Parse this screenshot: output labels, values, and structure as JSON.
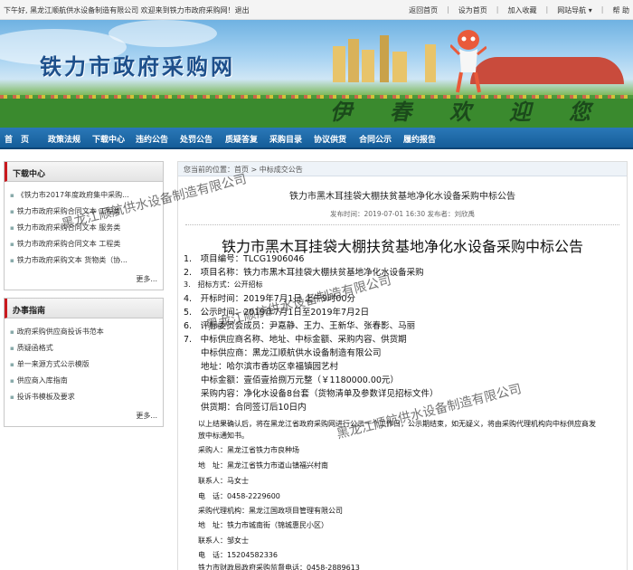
{
  "topbar": {
    "greeting": "下午好, 黑龙江顺航供水设备制造有限公司 欢迎来到铁力市政府采购网！退出",
    "links": [
      "返回首页",
      "设为首页",
      "加入收藏",
      "网站导航 ▾",
      "帮 助"
    ]
  },
  "banner": {
    "site_title": "铁力市政府采购网",
    "welcome": "伊春欢迎您"
  },
  "nav": {
    "items": [
      "首　页",
      "政策法规",
      "下载中心",
      "违约公告",
      "处罚公告",
      "质疑答复",
      "采购目录",
      "协议供货",
      "合同公示",
      "履约报告"
    ]
  },
  "sidebar": {
    "download": {
      "title": "下载中心",
      "items": [
        "《铁力市2017年度政府集中采购...",
        "铁力市政府采购合同文本 工程类",
        "铁力市政府采购合同文本 服务类",
        "铁力市政府采购合同文本 工程类",
        "铁力市政府采购文本 货物类（协..."
      ],
      "more": "更多..."
    },
    "guide": {
      "title": "办事指南",
      "items": [
        "政府采购供应商投诉书范本",
        "质疑函格式",
        "单一来源方式公示模版",
        "供应商入库指南",
        "投诉书模板及要求"
      ],
      "more": "更多..."
    }
  },
  "main": {
    "breadcrumb": "您当前的位置：首页 > 中标成交公告",
    "article_title": "铁力市黑木耳挂袋大棚扶贫基地净化水设备采购中标公告",
    "meta": "发布时间：2019-07-01 16:30  发布者：刘欣禹",
    "body_title": "铁力市黑木耳挂袋大棚扶贫基地净化水设备采购中标公告",
    "lines": [
      "1.　项目编号：TLCG1906046",
      "2.　项目名称：铁力市黑木耳挂袋大棚扶贫基地净化水设备采购",
      "3.　招标方式：公开招标",
      "4.　开标时间：2019年7月1日 上午9时00分",
      "5.　公示时间：2019年7月1日至2019年7月2日",
      "6.　评标委员会成员：尹嘉静、王力、王新华、张春影、马丽",
      "7.　中标供应商名称、地址、中标金额、采购内容、供货期",
      "　　中标供应商：黑龙江顺航供水设备制造有限公司",
      "　　地址：哈尔滨市香坊区幸福镇园艺村",
      "　　中标金额：壹佰壹拾捌万元整（￥1180000.00元）",
      "　　采购内容：净化水设备8台套（货物清单及参数详见招标文件）",
      "　　供货期：合同签订后10日内"
    ],
    "notice": [
      "以上结果确认后，将在黑龙江省政府采购网进行公示一个工作日，公示期结束，如无疑义，将由采购代理机构向中标供应商发",
      "放中标通知书。"
    ],
    "contacts": [
      "采购人：黑龙江省铁力市良种场",
      "地　址：黑龙江省铁力市道山镇福兴村南",
      "联系人：马女士",
      "电　话：0458-2229600",
      "采购代理机构：黑龙江国政项目管理有限公司",
      "地　址：铁力市城南街（锦城惠民小区）",
      "联系人：邹女士",
      "电　话：15204582336",
      "铁力市财政局政府采购监督电话：0458-2889613"
    ]
  },
  "watermark": "黑龙江顺航供水设备制造有限公司"
}
